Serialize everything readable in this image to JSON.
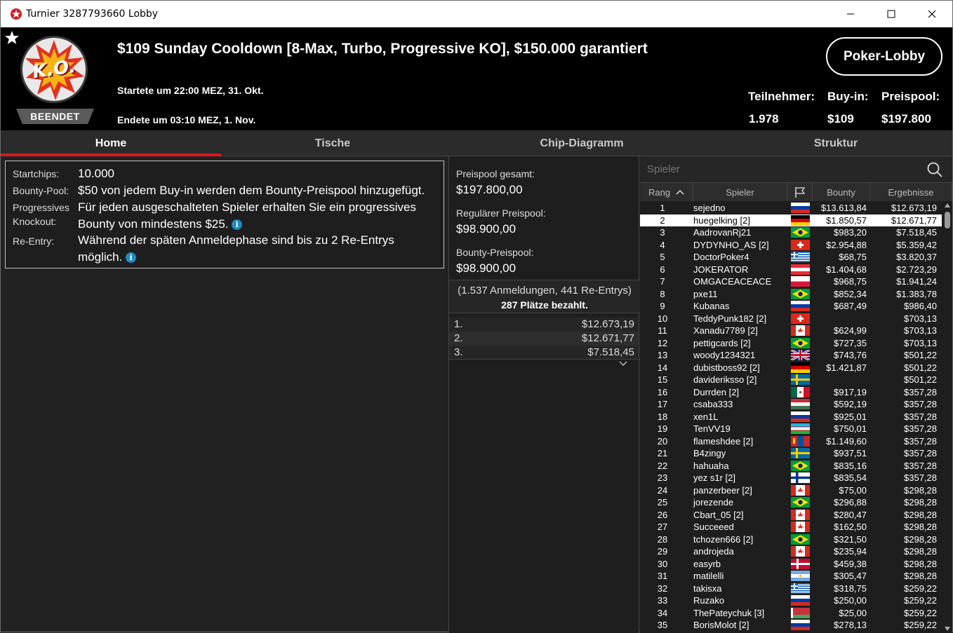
{
  "window": {
    "title": "Turnier 3287793660 Lobby"
  },
  "header": {
    "title": "$109 Sunday Cooldown [8-Max, Turbo, Progressive KO], $150.000 garantiert",
    "started": "Startete um 22:00 MEZ, 31. Okt.",
    "ended": "Endete um 03:10 MEZ, 1. Nov.",
    "status_badge": "BEENDET",
    "logo_text": "K.O.",
    "lobby_button": "Poker-Lobby",
    "stats": {
      "players_label": "Teilnehmer:",
      "players_value": "1.978",
      "buyin_label": "Buy-in:",
      "buyin_value": "$109",
      "prizepool_label": "Preispool:",
      "prizepool_value": "$197.800"
    }
  },
  "tabs": [
    "Home",
    "Tische",
    "Chip-Diagramm",
    "Struktur"
  ],
  "active_tab": "Home",
  "info": {
    "startchips_label": "Startchips:",
    "startchips_value": "10.000",
    "bounty_label": "Bounty-Pool:",
    "bounty_value": "$50 von jedem Buy-in werden dem Bounty-Preispool hinzugefügt.",
    "pko_label_1": "Progressives",
    "pko_label_2": "Knockout:",
    "pko_value_1": "Für jeden ausgeschalteten Spieler erhalten Sie ein progressives",
    "pko_value_2": "Bounty von mindestens $25.",
    "reentry_label": "Re-Entry:",
    "reentry_value_1": "Während der späten Anmeldephase sind bis zu 2 Re-Entrys",
    "reentry_value_2": "möglich."
  },
  "prize": {
    "total_label": "Preispool gesamt:",
    "total_value": "$197.800,00",
    "regular_label": "Regulärer Preispool:",
    "regular_value": "$98.900,00",
    "bounty_label": "Bounty-Preispool:",
    "bounty_value": "$98.900,00",
    "registrations": "(1.537 Anmeldungen, 441 Re-Entrys)",
    "paid": "287 Plätze bezahlt.",
    "payouts": [
      {
        "place": "1.",
        "amount": "$12.673,19"
      },
      {
        "place": "2.",
        "amount": "$12.671,77"
      },
      {
        "place": "3.",
        "amount": "$7.518,45"
      }
    ]
  },
  "players": {
    "search_placeholder": "Spieler",
    "columns": {
      "rank": "Rang",
      "player": "Spieler",
      "bounty": "Bounty",
      "results": "Ergebnisse"
    },
    "selected_rank": "2",
    "rows": [
      {
        "rank": "1",
        "name": "sejedno",
        "flag": "ru",
        "bounty": "$13.613,84",
        "result": "$12.673,19"
      },
      {
        "rank": "2",
        "name": "huegelking [2]",
        "flag": "de",
        "bounty": "$1.850,57",
        "result": "$12.671,77"
      },
      {
        "rank": "3",
        "name": "AadrovanRj21",
        "flag": "br",
        "bounty": "$983,20",
        "result": "$7.518,45"
      },
      {
        "rank": "4",
        "name": "DYDYNHO_AS [2]",
        "flag": "ch",
        "bounty": "$2.954,88",
        "result": "$5.359,42"
      },
      {
        "rank": "5",
        "name": "DoctorPoker4",
        "flag": "gr",
        "bounty": "$68,75",
        "result": "$3.820,37"
      },
      {
        "rank": "6",
        "name": "JOKERATOR",
        "flag": "at",
        "bounty": "$1.404,68",
        "result": "$2.723,29"
      },
      {
        "rank": "7",
        "name": "OMGACEACEACE",
        "flag": "pl",
        "bounty": "$968,75",
        "result": "$1.941,24"
      },
      {
        "rank": "8",
        "name": "pxe11",
        "flag": "br",
        "bounty": "$852,34",
        "result": "$1.383,78"
      },
      {
        "rank": "9",
        "name": "Kubanas",
        "flag": "ru",
        "bounty": "$687,49",
        "result": "$986,40"
      },
      {
        "rank": "10",
        "name": "TeddyPunk182 [2]",
        "flag": "ch",
        "bounty": "",
        "result": "$703,13"
      },
      {
        "rank": "11",
        "name": "Xanadu7789 [2]",
        "flag": "ca",
        "bounty": "$624,99",
        "result": "$703,13"
      },
      {
        "rank": "12",
        "name": "pettigcards [2]",
        "flag": "br",
        "bounty": "$727,35",
        "result": "$703,13"
      },
      {
        "rank": "13",
        "name": "woody1234321",
        "flag": "gb",
        "bounty": "$743,76",
        "result": "$501,22"
      },
      {
        "rank": "14",
        "name": "dubistboss92 [2]",
        "flag": "de",
        "bounty": "$1.421,87",
        "result": "$501,22"
      },
      {
        "rank": "15",
        "name": "davideriksso [2]",
        "flag": "se",
        "bounty": "",
        "result": "$501,22"
      },
      {
        "rank": "16",
        "name": "Durrden [2]",
        "flag": "mx",
        "bounty": "$917,19",
        "result": "$357,28"
      },
      {
        "rank": "17",
        "name": "csaba333",
        "flag": "hu",
        "bounty": "$592,19",
        "result": "$357,28"
      },
      {
        "rank": "18",
        "name": "xen1L",
        "flag": "ru",
        "bounty": "$925,01",
        "result": "$357,28"
      },
      {
        "rank": "19",
        "name": "TenVV19",
        "flag": "uz",
        "bounty": "$750,01",
        "result": "$357,28"
      },
      {
        "rank": "20",
        "name": "flameshdee [2]",
        "flag": "mn",
        "bounty": "$1.149,60",
        "result": "$357,28"
      },
      {
        "rank": "21",
        "name": "B4zingy",
        "flag": "se",
        "bounty": "$937,51",
        "result": "$357,28"
      },
      {
        "rank": "22",
        "name": "hahuaha",
        "flag": "br",
        "bounty": "$835,16",
        "result": "$357,28"
      },
      {
        "rank": "23",
        "name": "yez s1r [2]",
        "flag": "fi",
        "bounty": "$835,54",
        "result": "$357,28"
      },
      {
        "rank": "24",
        "name": "panzerbeer [2]",
        "flag": "ca",
        "bounty": "$75,00",
        "result": "$298,28"
      },
      {
        "rank": "25",
        "name": "jorezende",
        "flag": "br",
        "bounty": "$296,88",
        "result": "$298,28"
      },
      {
        "rank": "26",
        "name": "Cbart_05 [2]",
        "flag": "ca",
        "bounty": "$280,47",
        "result": "$298,28"
      },
      {
        "rank": "27",
        "name": "Succeeed",
        "flag": "ca",
        "bounty": "$162,50",
        "result": "$298,28"
      },
      {
        "rank": "28",
        "name": "tchozen666 [2]",
        "flag": "br",
        "bounty": "$321,50",
        "result": "$298,28"
      },
      {
        "rank": "29",
        "name": "androjeda",
        "flag": "ca",
        "bounty": "$235,94",
        "result": "$298,28"
      },
      {
        "rank": "30",
        "name": "easyrb",
        "flag": "dk",
        "bounty": "$459,38",
        "result": "$298,28"
      },
      {
        "rank": "31",
        "name": "matilelli",
        "flag": "ar",
        "bounty": "$305,47",
        "result": "$298,28"
      },
      {
        "rank": "32",
        "name": "takisxa",
        "flag": "gr",
        "bounty": "$318,75",
        "result": "$259,22"
      },
      {
        "rank": "33",
        "name": "Ruzako",
        "flag": "ru",
        "bounty": "$250,00",
        "result": "$259,22"
      },
      {
        "rank": "34",
        "name": "ThePateychuk [3]",
        "flag": "by",
        "bounty": "$25,00",
        "result": "$259,22"
      },
      {
        "rank": "35",
        "name": "BorisMolot [2]",
        "flag": "ru",
        "bounty": "$278,13",
        "result": "$259,22"
      }
    ]
  },
  "colors": {
    "accent_red": "#d7191c",
    "header_bg": "#000000",
    "panel_bg": "#1e1e1e",
    "info_blue": "#1e8bc3"
  }
}
